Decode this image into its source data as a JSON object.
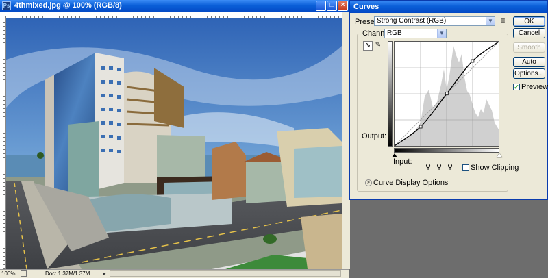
{
  "document": {
    "title": "4thmixed.jpg @ 100% (RGB/8)",
    "app_icon": "ps-icon",
    "controls": {
      "minimize": "_",
      "maximize": "□",
      "close": "×"
    },
    "status": {
      "zoom": "100%",
      "doc_info": "Doc: 1.37M/1.37M"
    }
  },
  "curves": {
    "title": "Curves",
    "preset_label": "Preset:",
    "preset_value": "Strong Contrast (RGB)",
    "channel_label": "Channel:",
    "channel_value": "RGB",
    "output_label": "Output:",
    "input_label": "Input:",
    "show_clipping_label": "Show Clipping",
    "show_clipping_checked": false,
    "display_options_label": "Curve Display Options",
    "buttons": {
      "ok": "OK",
      "cancel": "Cancel",
      "smooth": "Smooth",
      "auto": "Auto",
      "options": "Options..."
    },
    "preview_label": "Preview",
    "preview_checked": true,
    "curve_points": [
      [
        0,
        0
      ],
      [
        64,
        47
      ],
      [
        128,
        128
      ],
      [
        191,
        208
      ],
      [
        255,
        255
      ]
    ]
  },
  "colors": {
    "title_bar": "#0a5fd8",
    "dialog_bg": "#ece9d8",
    "workspace": "#6d6d6d"
  }
}
